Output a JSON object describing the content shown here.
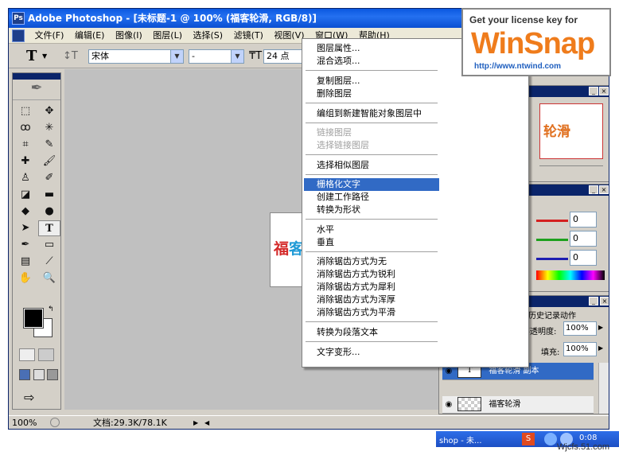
{
  "window": {
    "title": "Adobe Photoshop - [未标题-1 @ 100% (福客轮滑, RGB/8)]"
  },
  "menubar": [
    "文件(F)",
    "编辑(E)",
    "图像(I)",
    "图层(L)",
    "选择(S)",
    "滤镜(T)",
    "视图(V)",
    "窗口(W)",
    "帮助(H)"
  ],
  "options": {
    "font_family": "宋体",
    "font_style": "-",
    "font_size": "24 点"
  },
  "document": {
    "text_red": "福",
    "text_blue": "客",
    "preview_text": "轮滑"
  },
  "status": {
    "zoom": "100%",
    "doc_size": "文档:29.3K/78.1K"
  },
  "context_menu": {
    "items": [
      {
        "label": "图层属性...",
        "disabled": false
      },
      {
        "label": "混合选项...",
        "disabled": false
      },
      {
        "label": "复制图层...",
        "disabled": false
      },
      {
        "label": "删除图层",
        "disabled": false
      },
      {
        "label": "编组到新建智能对象图层中",
        "disabled": false
      },
      {
        "label": "链接图层",
        "disabled": true
      },
      {
        "label": "选择链接图层",
        "disabled": true
      },
      {
        "label": "选择相似图层",
        "disabled": false
      },
      {
        "label": "栅格化文字",
        "disabled": false,
        "highlighted": true
      },
      {
        "label": "创建工作路径",
        "disabled": false
      },
      {
        "label": "转换为形状",
        "disabled": false
      },
      {
        "label": "水平",
        "disabled": false
      },
      {
        "label": "垂直",
        "disabled": false
      },
      {
        "label": "消除锯齿方式为无",
        "disabled": false
      },
      {
        "label": "消除锯齿方式为锐利",
        "disabled": false
      },
      {
        "label": "消除锯齿方式为犀利",
        "disabled": false
      },
      {
        "label": "消除锯齿方式为浑厚",
        "disabled": false
      },
      {
        "label": "消除锯齿方式为平滑",
        "disabled": false
      },
      {
        "label": "转换为段落文本",
        "disabled": false
      },
      {
        "label": "文字变形...",
        "disabled": false
      }
    ]
  },
  "color_panel": {
    "r": "0",
    "g": "0",
    "b": "0"
  },
  "layers_panel": {
    "tab_history": "历史记录",
    "tab_actions": "动作",
    "opacity_label": "不透明度:",
    "opacity_value": "100%",
    "fill_label": "填充:",
    "fill_value": "100%",
    "layers": [
      {
        "name": "福客轮滑 副本",
        "selected": true,
        "thumb": "T"
      },
      {
        "name": "福客轮滑",
        "selected": false,
        "thumb": ""
      }
    ]
  },
  "winsnap": {
    "line1": "Get your license key for",
    "logo": "WinSnap",
    "url": "http://www.ntwind.com"
  },
  "watermark": "Wjcfs.51.com",
  "taskbar": {
    "app": "shop - 未...",
    "clock": "0:08"
  },
  "colors": {
    "highlight": "#316ac5",
    "title_bar": "#0a58e0",
    "winsnap_orange": "#ef7c1c"
  }
}
